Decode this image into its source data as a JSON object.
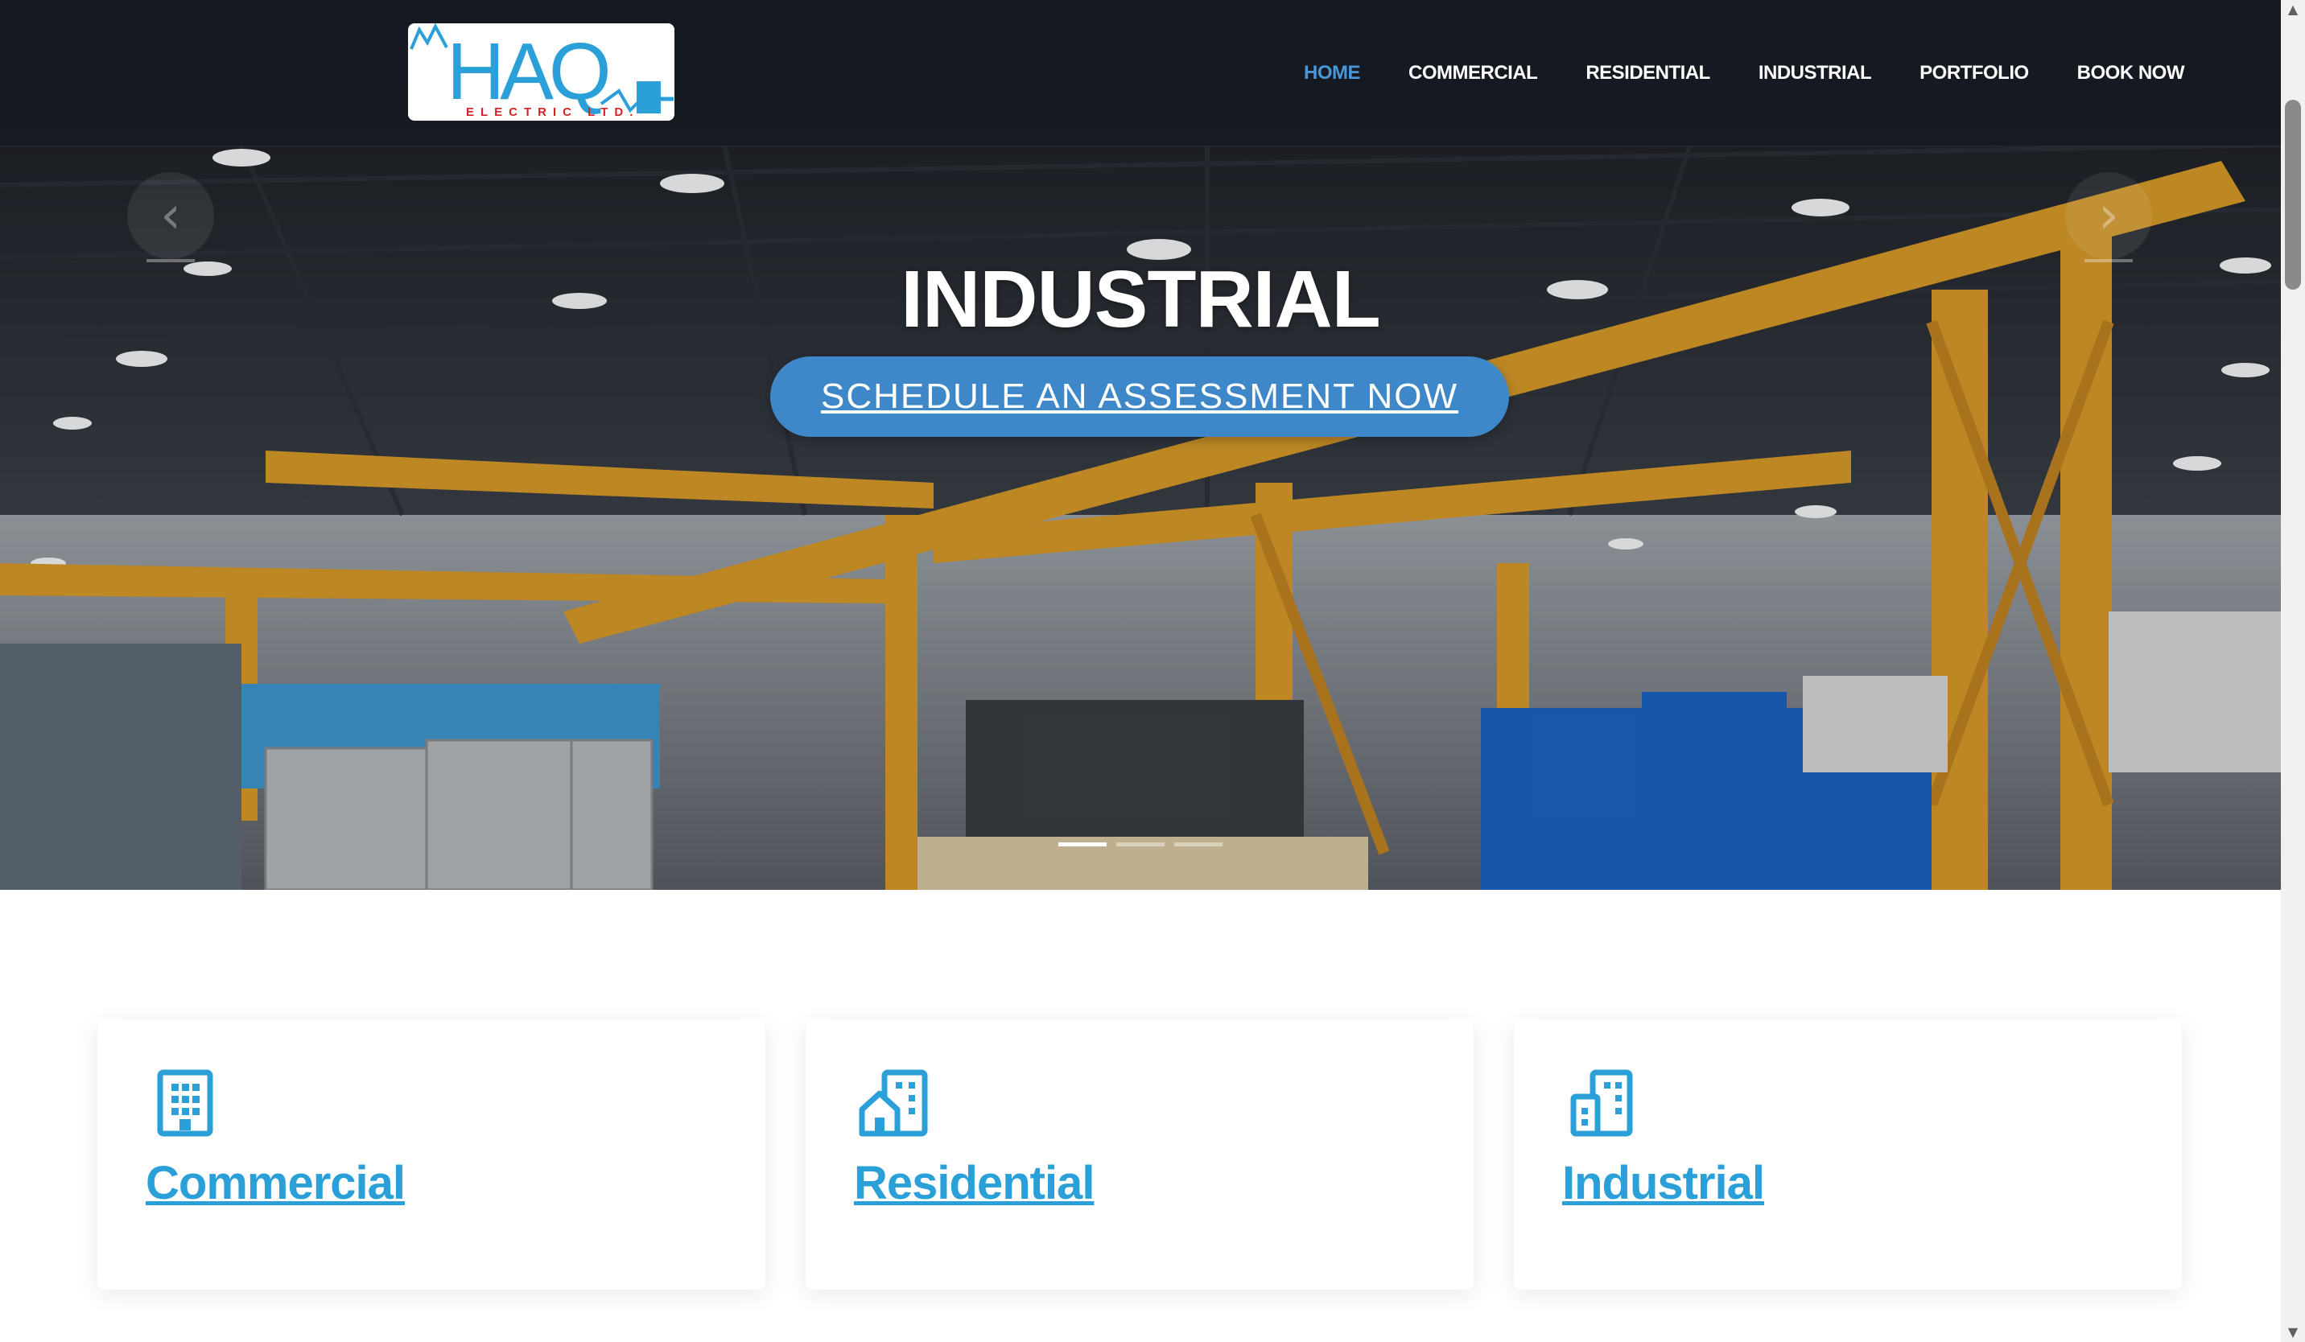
{
  "logo": {
    "main": "HAQ",
    "sub": "ELECTRIC LTD."
  },
  "nav": [
    {
      "label": "HOME",
      "active": true
    },
    {
      "label": "COMMERCIAL",
      "active": false
    },
    {
      "label": "RESIDENTIAL",
      "active": false
    },
    {
      "label": "INDUSTRIAL",
      "active": false
    },
    {
      "label": "PORTFOLIO",
      "active": false
    },
    {
      "label": "BOOK NOW",
      "active": false
    }
  ],
  "hero": {
    "title": "INDUSTRIAL",
    "cta_label": "SCHEDULE AN ASSESSMENT NOW",
    "slide_count": 3,
    "active_slide": 1,
    "prev_glyph": "‹",
    "next_glyph": "›"
  },
  "cards": [
    {
      "title": "Commercial",
      "icon": "office-building-icon"
    },
    {
      "title": "Residential",
      "icon": "house-building-icon"
    },
    {
      "title": "Industrial",
      "icon": "city-buildings-icon"
    }
  ],
  "colors": {
    "accent": "#2a9fd8",
    "nav_active": "#4a97d8",
    "cta": "#3e88c9",
    "header_bg": "#161a21"
  }
}
